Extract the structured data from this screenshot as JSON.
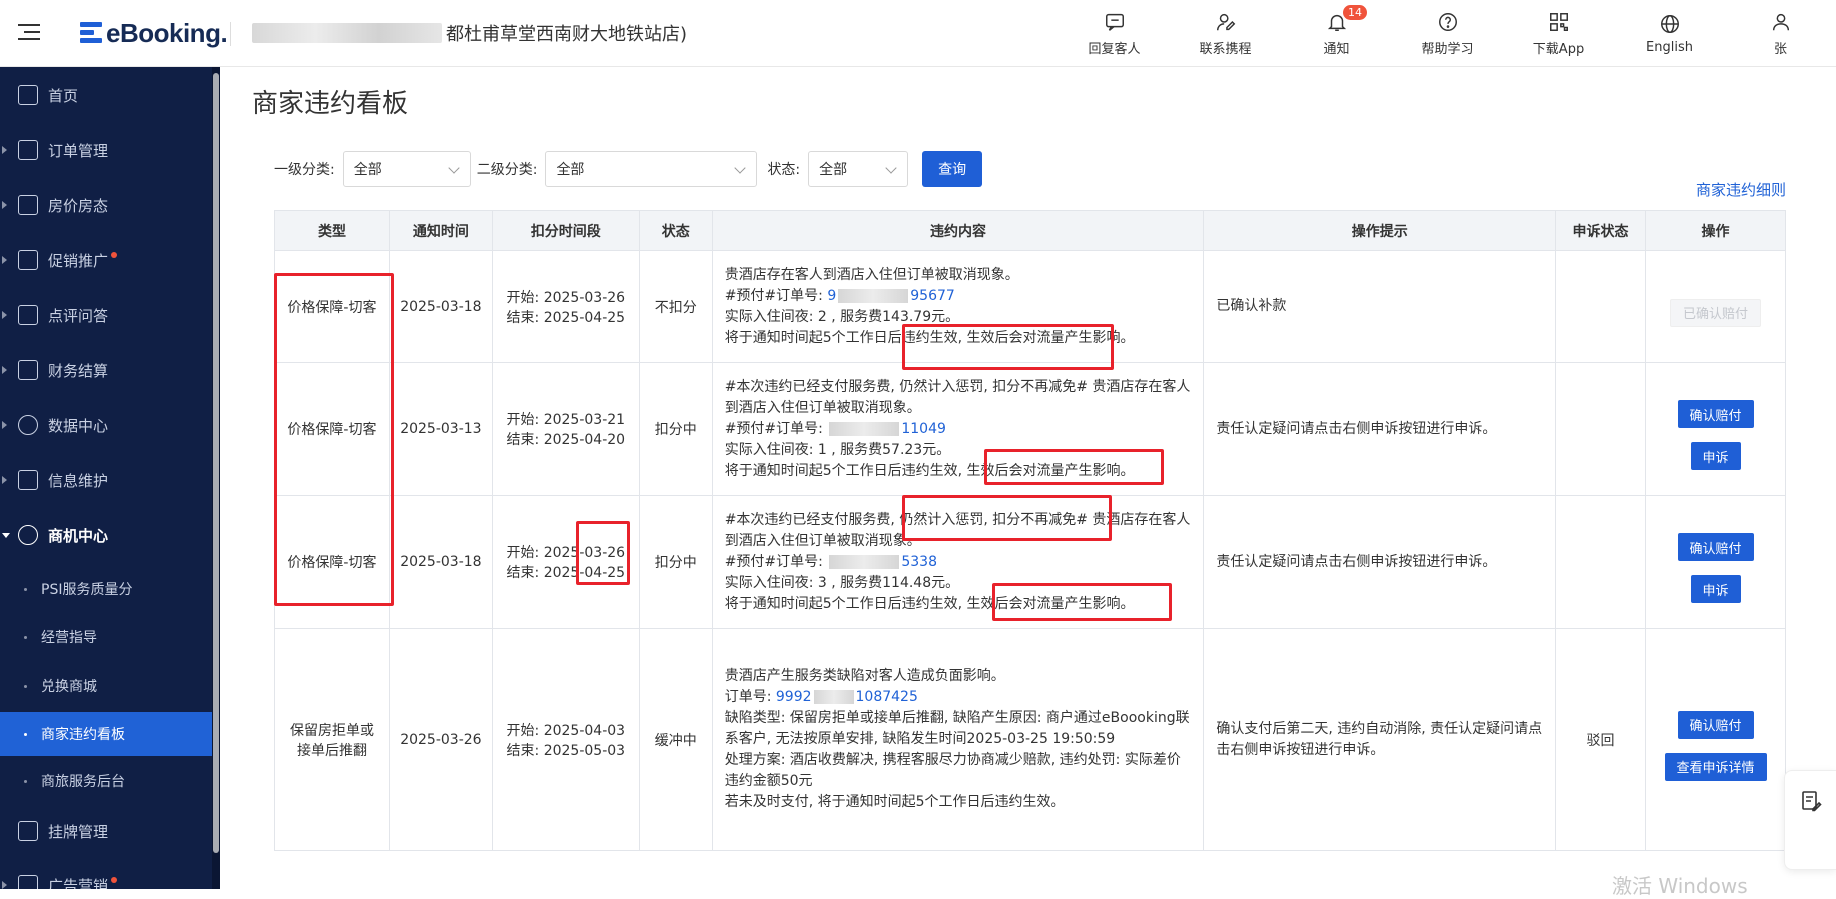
{
  "header": {
    "logo_text": "eBooking.",
    "hotel_name": "都杜甫草堂西南财大地铁站店)",
    "actions": [
      {
        "label": "回复客人",
        "icon": "chat-icon"
      },
      {
        "label": "联系携程",
        "icon": "contact-icon"
      },
      {
        "label": "通知",
        "icon": "bell-icon",
        "badge": "14"
      },
      {
        "label": "帮助学习",
        "icon": "help-icon"
      },
      {
        "label": "下载App",
        "icon": "qrcode-icon"
      },
      {
        "label": "English",
        "icon": "globe-icon"
      },
      {
        "label": "张",
        "icon": "user-icon"
      }
    ]
  },
  "sidebar": {
    "items": [
      {
        "label": "首页"
      },
      {
        "label": "订单管理"
      },
      {
        "label": "房价房态"
      },
      {
        "label": "促销推广"
      },
      {
        "label": "点评问答"
      },
      {
        "label": "财务结算"
      },
      {
        "label": "数据中心"
      },
      {
        "label": "信息维护"
      },
      {
        "label": "商机中心"
      }
    ],
    "sub_items": [
      {
        "label": "PSI服务质量分"
      },
      {
        "label": "经营指导"
      },
      {
        "label": "兑换商城"
      },
      {
        "label": "商家违约看板"
      },
      {
        "label": "商旅服务后台"
      }
    ],
    "bottom_items": [
      {
        "label": "挂牌管理"
      },
      {
        "label": "广告营销"
      }
    ]
  },
  "page": {
    "title": "商家违约看板",
    "detail_link": "商家违约细则",
    "filters": {
      "level1_label": "一级分类:",
      "level1_value": "全部",
      "level2_label": "二级分类:",
      "level2_value": "全部",
      "status_label": "状态:",
      "status_value": "全部",
      "query_button": "查询"
    }
  },
  "table": {
    "columns": [
      "类型",
      "通知时间",
      "扣分时间段",
      "状态",
      "违约内容",
      "操作提示",
      "申诉状态",
      "操作"
    ],
    "rows": [
      {
        "type": "价格保障-切客",
        "notify_time": "2025-03-18",
        "period_start": "开始: 2025-03-26",
        "period_end": "结束: 2025-04-25",
        "status": "不扣分",
        "content_1": "贵酒店存在客人到酒店入住但订单被取消现象。",
        "order_prefix": "#预付#订单号:",
        "order_no_head": "9",
        "order_no_tail": "95677",
        "content_3": "实际入住间夜: 2 , 服务费143.79元。",
        "content_4": "将于通知时间起5个工作日后违约生效, 生效后会对流量产生影响。",
        "tip": "已确认补款",
        "appeal_status": "",
        "op1": "已确认赔付"
      },
      {
        "type": "价格保障-切客",
        "notify_time": "2025-03-13",
        "period_start": "开始: 2025-03-21",
        "period_end": "结束: 2025-04-20",
        "status": "扣分中",
        "content_1": "#本次违约已经支付服务费, 仍然计入惩罚, 扣分不再减免# 贵酒店存在客人到酒店入住但订单被取消现象。",
        "order_prefix": "#预付#订单号:",
        "order_no_head": "",
        "order_no_tail": "11049",
        "content_3": "实际入住间夜: 1 , 服务费57.23元。",
        "content_4": "将于通知时间起5个工作日后违约生效, 生效后会对流量产生影响。",
        "tip": "责任认定疑问请点击右侧申诉按钮进行申诉。",
        "appeal_status": "",
        "op1": "确认赔付",
        "op2": "申诉"
      },
      {
        "type": "价格保障-切客",
        "notify_time": "2025-03-18",
        "period_start": "开始: 2025-03-26",
        "period_end": "结束: 2025-04-25",
        "status": "扣分中",
        "content_1": "#本次违约已经支付服务费, 仍然计入惩罚, 扣分不再减免# 贵酒店存在客人到酒店入住但订单被取消现象。",
        "order_prefix": "#预付#订单号:",
        "order_no_head": "",
        "order_no_tail": "5338",
        "content_3": "实际入住间夜: 3 , 服务费114.48元。",
        "content_4": "将于通知时间起5个工作日后违约生效, 生效后会对流量产生影响。",
        "tip": "责任认定疑问请点击右侧申诉按钮进行申诉。",
        "appeal_status": "",
        "op1": "确认赔付",
        "op2": "申诉"
      },
      {
        "type": "保留房拒单或接单后推翻",
        "notify_time": "2025-03-26",
        "period_start": "开始: 2025-04-03",
        "period_end": "结束: 2025-05-03",
        "status": "缓冲中",
        "content_1": "贵酒店产生服务类缺陷对客人造成负面影响。",
        "order_prefix": "订单号:",
        "order_no_head": "9992",
        "order_no_tail": "1087425",
        "content_3": "缺陷类型: 保留房拒单或接单后推翻, 缺陷产生原因: 商户通过eBoooking联系客户, 无法按原单安排, 缺陷发生时间2025-03-25 19:50:59",
        "content_4": "处理方案: 酒店收费解决, 携程客服尽力协商减少赔款, 违约处罚: 实际差价",
        "content_5": "违约金额50元",
        "content_6": "若未及时支付, 将于通知时间起5个工作日后违约生效。",
        "tip": "确认支付后第二天, 违约自动消除, 责任认定疑问请点击右侧申诉按钮进行申诉。",
        "appeal_status": "驳回",
        "op1": "确认赔付",
        "op2": "查看申诉详情"
      }
    ]
  },
  "watermark": "激活 Windows",
  "colors": {
    "primary": "#1f5fd6",
    "sidebar_bg": "#101f45",
    "highlight": "#e8222b"
  }
}
